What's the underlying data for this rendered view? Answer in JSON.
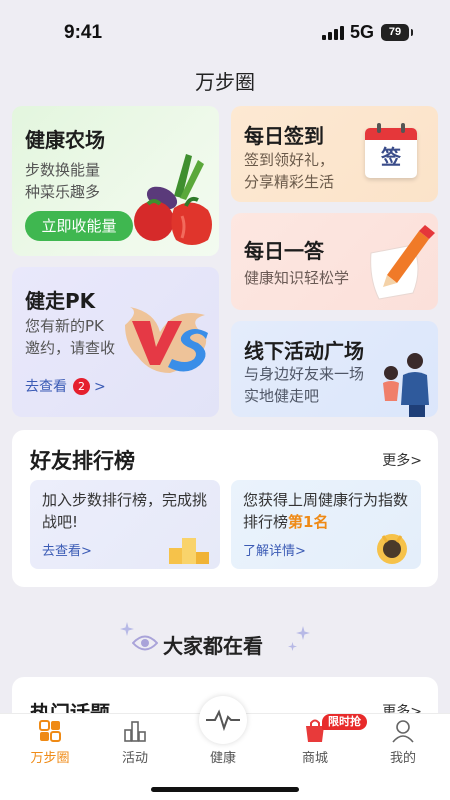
{
  "status": {
    "time": "9:41",
    "network": "5G",
    "battery": "79"
  },
  "header": {
    "title": "万步圈"
  },
  "cards": {
    "farm": {
      "title": "健康农场",
      "desc1": "步数换能量",
      "desc2": "种菜乐趣多",
      "button": "立即收能量"
    },
    "pk": {
      "title": "健走PK",
      "desc1": "您有新的PK",
      "desc2": "邀约，请查收",
      "link": "去查看",
      "badge": "2",
      "chevron": ">"
    },
    "sign": {
      "title": "每日签到",
      "desc1": "签到领好礼，",
      "desc2": "分享精彩生活",
      "stamp": "签"
    },
    "quiz": {
      "title": "每日一答",
      "desc": "健康知识轻松学"
    },
    "event": {
      "title": "线下活动广场",
      "desc1": "与身边好友来一场",
      "desc2": "实地健走吧"
    }
  },
  "ranking": {
    "title": "好友排行榜",
    "more": "更多>",
    "left": {
      "text": "加入步数排行榜，完成挑战吧!",
      "link": "去查看>"
    },
    "right": {
      "text_before": "您获得上周健康行为指数排行榜",
      "highlight": "第1名",
      "link": "了解详情>"
    }
  },
  "watch": {
    "title": "大家都在看"
  },
  "hot": {
    "title": "热门话题",
    "more": "更多>"
  },
  "tabs": [
    {
      "label": "万步圈",
      "icon": "wanbuquan-icon",
      "active": true
    },
    {
      "label": "活动",
      "icon": "activity-icon"
    },
    {
      "label": "健康",
      "icon": "heartbeat-icon"
    },
    {
      "label": "商城",
      "icon": "mall-icon",
      "badge": "限时抢"
    },
    {
      "label": "我的",
      "icon": "profile-icon"
    }
  ],
  "colors": {
    "accent": "#ef8a15",
    "green": "#3fb750",
    "link": "#3b5bb5",
    "badge": "#e5202e"
  }
}
